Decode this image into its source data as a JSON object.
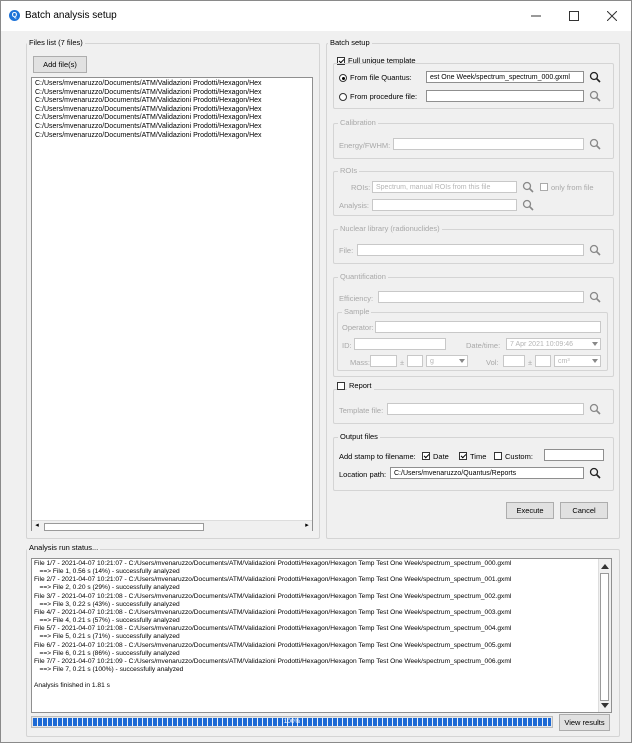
{
  "window": {
    "title": "Batch analysis setup",
    "icon": "app-logo-icon",
    "controls": [
      "minimize-icon",
      "maximize-icon",
      "close-icon"
    ]
  },
  "files": {
    "group_label": "Files list (7 files)",
    "add_button": "Add file(s)",
    "items": [
      "C:/Users/mvenaruzzo/Documents/ATM/Validazioni Prodotti/Hexagon/Hex",
      "C:/Users/mvenaruzzo/Documents/ATM/Validazioni Prodotti/Hexagon/Hex",
      "C:/Users/mvenaruzzo/Documents/ATM/Validazioni Prodotti/Hexagon/Hex",
      "C:/Users/mvenaruzzo/Documents/ATM/Validazioni Prodotti/Hexagon/Hex",
      "C:/Users/mvenaruzzo/Documents/ATM/Validazioni Prodotti/Hexagon/Hex",
      "C:/Users/mvenaruzzo/Documents/ATM/Validazioni Prodotti/Hexagon/Hex",
      "C:/Users/mvenaruzzo/Documents/ATM/Validazioni Prodotti/Hexagon/Hex"
    ]
  },
  "batch": {
    "group_label": "Batch setup",
    "full_unique_template": "Full unique template",
    "from_file_quantus": "From file Quantus:",
    "from_file_value": "est One Week/spectrum_spectrum_000.gxml",
    "from_procedure_file": "From procedure file:",
    "calibration": {
      "label": "Calibration",
      "energy": "Energy/FWHM:"
    },
    "rois": {
      "label": "ROIs",
      "rois_label": "ROIs:",
      "rois_value": "Spectrum, manual ROIs from this file",
      "only_from_file": "only from file",
      "analysis": "Analysis:"
    },
    "nuclear_library": {
      "label": "Nuclear library (radionuclides)",
      "file": "File:"
    },
    "quantification": {
      "label": "Quantification",
      "efficiency": "Efficiency:",
      "sample": "Sample",
      "operator": "Operator:",
      "id": "ID:",
      "datetime_label": "Date/time:",
      "datetime_value": "7 Apr 2021 10:09:46",
      "mass": "Mass:",
      "mass_pm": "±",
      "mass_unit": "g",
      "vol": "Vol:",
      "vol_pm": "±",
      "vol_unit": "cm³"
    },
    "report": {
      "label": "Report",
      "template_file": "Template file:"
    },
    "output": {
      "label": "Output files",
      "add_stamp": "Add stamp to filename:",
      "date": "Date",
      "time": "Time",
      "custom": "Custom:",
      "location_label": "Location path:",
      "location_value": "C:/Users/mvenaruzzo/Quantus/Reports"
    },
    "execute": "Execute",
    "cancel": "Cancel"
  },
  "status": {
    "group_label": "Analysis run status...",
    "lines": [
      "File 1/7 - 2021-04-07 10:21:07 - C:/Users/mvenaruzzo/Documents/ATM/Validazioni Prodotti/Hexagon/Hexagon Temp Test One Week/spectrum_spectrum_000.gxml",
      "   ==> File 1, 0.56 s (14%) - successfully analyzed",
      "File 2/7 - 2021-04-07 10:21:07 - C:/Users/mvenaruzzo/Documents/ATM/Validazioni Prodotti/Hexagon/Hexagon Temp Test One Week/spectrum_spectrum_001.gxml",
      "   ==> File 2, 0.20 s (29%) - successfully analyzed",
      "File 3/7 - 2021-04-07 10:21:08 - C:/Users/mvenaruzzo/Documents/ATM/Validazioni Prodotti/Hexagon/Hexagon Temp Test One Week/spectrum_spectrum_002.gxml",
      "   ==> File 3, 0.22 s (43%) - successfully analyzed",
      "File 4/7 - 2021-04-07 10:21:08 - C:/Users/mvenaruzzo/Documents/ATM/Validazioni Prodotti/Hexagon/Hexagon Temp Test One Week/spectrum_spectrum_003.gxml",
      "   ==> File 4, 0.21 s (57%) - successfully analyzed",
      "File 5/7 - 2021-04-07 10:21:08 - C:/Users/mvenaruzzo/Documents/ATM/Validazioni Prodotti/Hexagon/Hexagon Temp Test One Week/spectrum_spectrum_004.gxml",
      "   ==> File 5, 0.21 s (71%) - successfully analyzed",
      "File 6/7 - 2021-04-07 10:21:08 - C:/Users/mvenaruzzo/Documents/ATM/Validazioni Prodotti/Hexagon/Hexagon Temp Test One Week/spectrum_spectrum_005.gxml",
      "   ==> File 6, 0.21 s (86%) - successfully analyzed",
      "File 7/7 - 2021-04-07 10:21:09 - C:/Users/mvenaruzzo/Documents/ATM/Validazioni Prodotti/Hexagon/Hexagon Temp Test One Week/spectrum_spectrum_006.gxml",
      "   ==> File 7, 0.21 s (100%) - successfully analyzed",
      "",
      "Analysis finished in 1.81 s"
    ],
    "progress": 1.0,
    "progress_label": "100%",
    "view_results": "View results"
  },
  "colors": {
    "accent": "#1c69d4",
    "disabled_text": "#a8a8a8"
  }
}
